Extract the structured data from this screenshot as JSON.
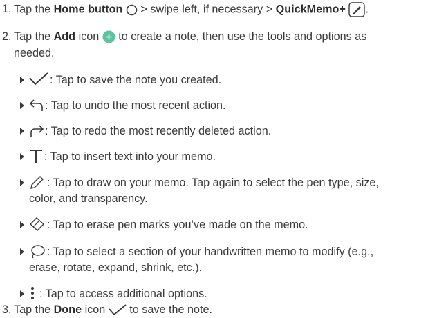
{
  "steps": [
    {
      "num": "1.",
      "p1": "Tap the ",
      "b1": "Home button",
      "p2": " > swipe left, if necessary > ",
      "b2": "QuickMemo+"
    },
    {
      "num": "2.",
      "p1": "Tap the ",
      "b1": "Add",
      "p2": " icon ",
      "p3": " to create a note, then use the tools and options as",
      "l2": "needed."
    },
    {
      "num": "3.",
      "p1": "Tap the ",
      "b1": "Done",
      "p2": " icon ",
      "p3": " to save the note."
    }
  ],
  "options": [
    {
      "icon": "checkmark-icon",
      "text": ": Tap to save the note you created."
    },
    {
      "icon": "undo-icon",
      "text": ": Tap to undo the most recent action."
    },
    {
      "icon": "redo-icon",
      "text": ": Tap to redo the most recently deleted action."
    },
    {
      "icon": "text-t-icon",
      "text": ": Tap to insert text into your memo."
    },
    {
      "icon": "pen-icon",
      "text": ": Tap to draw on your memo. Tap again to select the pen type, size,",
      "text2": "color, and transparency."
    },
    {
      "icon": "eraser-icon",
      "text": ": Tap to erase pen marks you’ve made on the memo."
    },
    {
      "icon": "lasso-icon",
      "text": ": Tap to select a section of your handwritten memo to modify (e.g.,",
      "text2": "erase, rotate, expand, shrink, etc.)."
    },
    {
      "icon": "more-options-icon",
      "text": ": Tap to access additional options."
    }
  ],
  "colors": {
    "add_icon": "#5cc3a0",
    "text": "#3a3a3a"
  }
}
